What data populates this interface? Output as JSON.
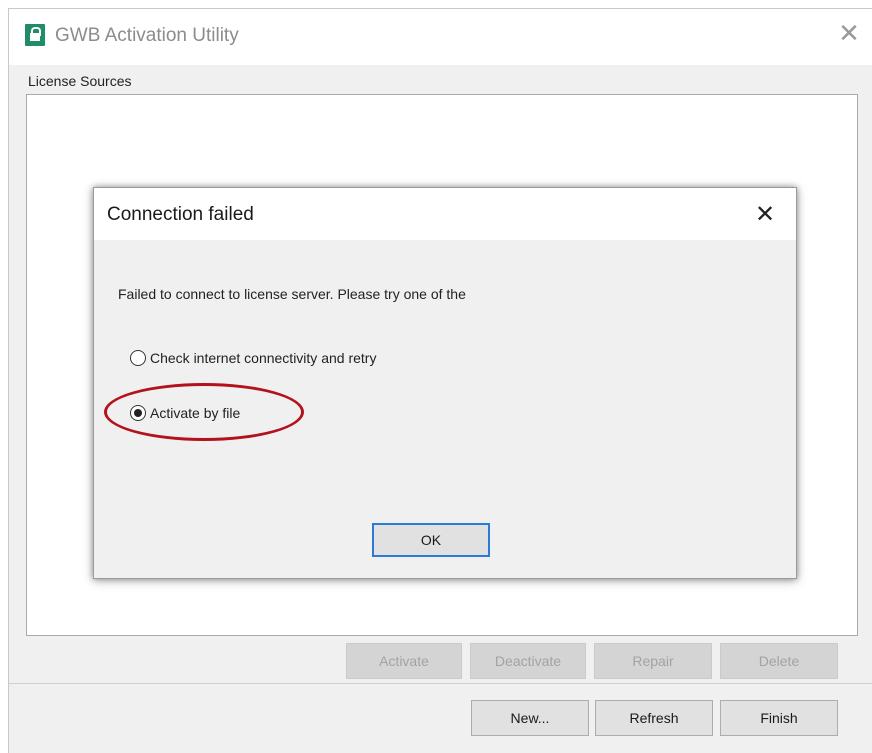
{
  "window": {
    "title": "GWB Activation Utility",
    "close_glyph": "✕",
    "icon": "lock-icon",
    "accent_color": "#1f8c6a"
  },
  "license_sources": {
    "label": "License Sources"
  },
  "action_buttons": {
    "activate": "Activate",
    "deactivate": "Deactivate",
    "repair": "Repair",
    "delete": "Delete"
  },
  "footer_buttons": {
    "new": "New...",
    "refresh": "Refresh",
    "finish": "Finish"
  },
  "dialog": {
    "title": "Connection failed",
    "close_glyph": "✕",
    "message": "Failed to connect to license server. Please try one of the",
    "options": [
      {
        "label": "Check internet connectivity and retry",
        "selected": false
      },
      {
        "label": "Activate by file",
        "selected": true
      }
    ],
    "ok_label": "OK",
    "highlight_color": "#b3121c"
  }
}
